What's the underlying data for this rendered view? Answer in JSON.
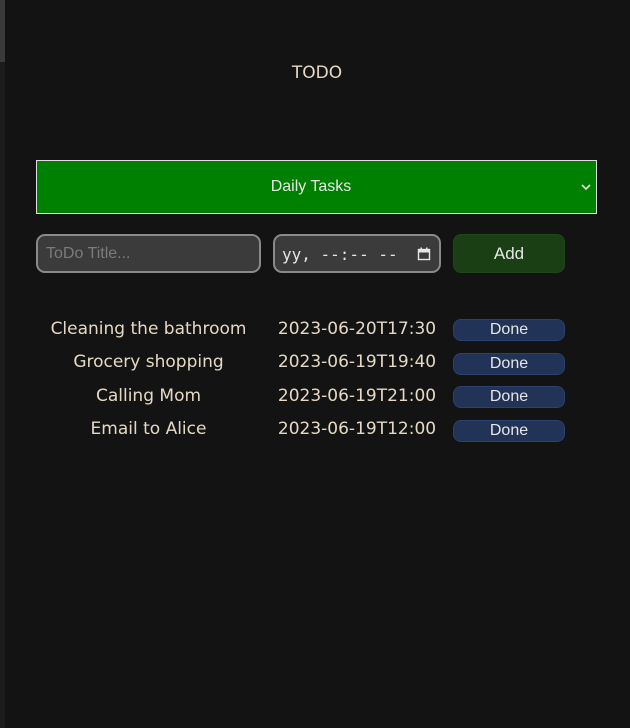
{
  "app": {
    "title": "TODO"
  },
  "category_select": {
    "selected": "Daily Tasks"
  },
  "new_task": {
    "title_placeholder": "ToDo Title...",
    "date_value_display": "yy, --:-- --",
    "add_label": "Add"
  },
  "tasks": [
    {
      "title": "Cleaning the bathroom",
      "datetime": "2023-06-20T17:30",
      "action_label": "Done"
    },
    {
      "title": "Grocery shopping",
      "datetime": "2023-06-19T19:40",
      "action_label": "Done"
    },
    {
      "title": "Calling Mom",
      "datetime": "2023-06-19T21:00",
      "action_label": "Done"
    },
    {
      "title": "Email to Alice",
      "datetime": "2023-06-19T12:00",
      "action_label": "Done"
    }
  ],
  "icons": {
    "dropdown": "chevron-down-icon",
    "date_picker": "calendar-icon"
  },
  "colors": {
    "background": "#131313",
    "select_background": "#008000",
    "add_button": "#1b3f15",
    "done_button": "#213457",
    "text": "#e5d9c5"
  }
}
